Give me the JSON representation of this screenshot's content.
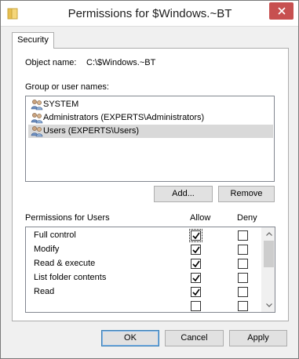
{
  "window": {
    "title": "Permissions for $Windows.~BT",
    "close_label": "Close"
  },
  "tabs": [
    {
      "label": "Security"
    }
  ],
  "object": {
    "label": "Object name:",
    "value": "C:\\$Windows.~BT"
  },
  "groups": {
    "label": "Group or user names:",
    "items": [
      {
        "name": "SYSTEM"
      },
      {
        "name": "Administrators (EXPERTS\\Administrators)"
      },
      {
        "name": "Users (EXPERTS\\Users)"
      }
    ],
    "selected": "Users (EXPERTS\\Users)"
  },
  "buttons": {
    "add": "Add...",
    "remove": "Remove",
    "ok": "OK",
    "cancel": "Cancel",
    "apply": "Apply"
  },
  "permissions": {
    "label": "Permissions for Users",
    "allow_header": "Allow",
    "deny_header": "Deny",
    "rows": [
      {
        "name": "Full control",
        "allow": true,
        "deny": false
      },
      {
        "name": "Modify",
        "allow": true,
        "deny": false
      },
      {
        "name": "Read & execute",
        "allow": true,
        "deny": false
      },
      {
        "name": "List folder contents",
        "allow": true,
        "deny": false
      },
      {
        "name": "Read",
        "allow": true,
        "deny": false
      }
    ]
  },
  "icons": {
    "app": "folder-icon",
    "close": "close-icon",
    "user": "users-icon",
    "scroll_up": "chevron-up-icon",
    "scroll_down": "chevron-down-icon",
    "check": "checkmark-icon"
  }
}
